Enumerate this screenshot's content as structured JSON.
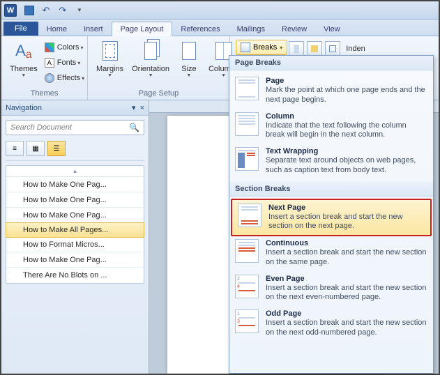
{
  "qat": {
    "app_char": "W"
  },
  "tabs": [
    "File",
    "Home",
    "Insert",
    "Page Layout",
    "References",
    "Mailings",
    "Review",
    "View"
  ],
  "active_tab": "Page Layout",
  "ribbon": {
    "themes": {
      "label": "Themes",
      "themes_btn": "Themes",
      "colors": "Colors",
      "fonts": "Fonts",
      "effects": "Effects"
    },
    "page_setup": {
      "label": "Page Setup",
      "margins": "Margins",
      "orientation": "Orientation",
      "size": "Size",
      "columns": "Columns",
      "breaks": "Breaks"
    },
    "indent_partial": "Inden"
  },
  "nav": {
    "title": "Navigation",
    "search_placeholder": "Search Document",
    "items": [
      "How to Make One Pag...",
      "How to Make One Pag...",
      "How to Make One Pag...",
      "How to Make All Pages...",
      "How to Format Micros...",
      "How to Make One Pag...",
      "There Are No Blots on ..."
    ],
    "selected_index": 3
  },
  "breaks_menu": {
    "section1": {
      "header": "Page Breaks",
      "items": [
        {
          "title": "Page",
          "desc": "Mark the point at which one page ends and the next page begins."
        },
        {
          "title": "Column",
          "desc": "Indicate that the text following the column break will begin in the next column."
        },
        {
          "title": "Text Wrapping",
          "desc": "Separate text around objects on web pages, such as caption text from body text."
        }
      ]
    },
    "section2": {
      "header": "Section Breaks",
      "items": [
        {
          "title": "Next Page",
          "desc": "Insert a section break and start the new section on the next page."
        },
        {
          "title": "Continuous",
          "desc": "Insert a section break and start the new section on the same page."
        },
        {
          "title": "Even Page",
          "desc": "Insert a section break and start the new section on the next even-numbered page."
        },
        {
          "title": "Odd Page",
          "desc": "Insert a section break and start the new section on the next odd-numbered page."
        }
      ],
      "highlight_index": 0
    }
  }
}
